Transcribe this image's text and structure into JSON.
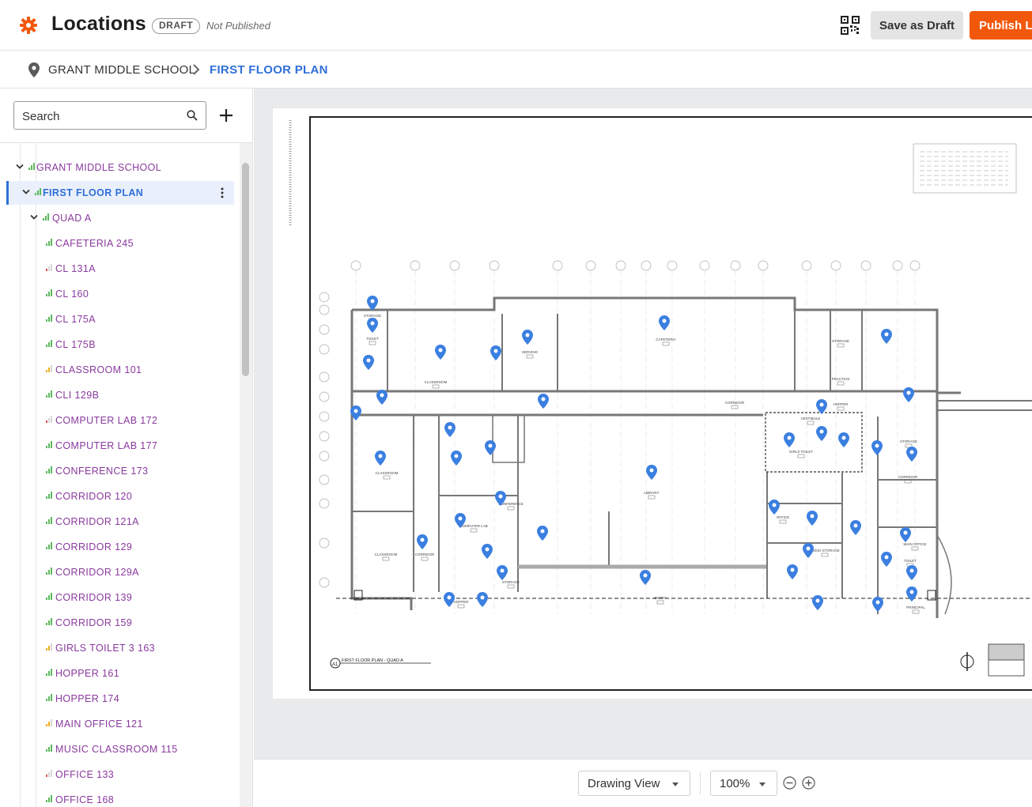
{
  "header": {
    "title": "Locations",
    "status_badge": "DRAFT",
    "publish_state": "Not Published",
    "save_draft_label": "Save as Draft",
    "publish_label": "Publish Lo",
    "logo_icon": "gear-logo-icon",
    "qr_icon": "qr-code-icon",
    "accent_color": "#f2580c"
  },
  "breadcrumb": {
    "items": [
      "GRANT MIDDLE SCHOOL",
      "FIRST FLOOR PLAN"
    ],
    "active_color": "#2f6fd8"
  },
  "sidebar": {
    "search_placeholder": "Search",
    "tree": [
      {
        "label": "GRANT MIDDLE SCHOOL",
        "level": 0,
        "expanded": true,
        "signal": "green"
      },
      {
        "label": "FIRST FLOOR PLAN",
        "level": 1,
        "expanded": true,
        "selected": true,
        "signal": "green"
      },
      {
        "label": "QUAD A",
        "level": 2,
        "expanded": true,
        "signal": "green"
      },
      {
        "label": "CAFETERIA 245",
        "level": 3,
        "signal": "green"
      },
      {
        "label": "CL 131A",
        "level": 3,
        "signal": "red"
      },
      {
        "label": "CL 160",
        "level": 3,
        "signal": "green"
      },
      {
        "label": "CL 175A",
        "level": 3,
        "signal": "green"
      },
      {
        "label": "CL 175B",
        "level": 3,
        "signal": "green"
      },
      {
        "label": "CLASSROOM 101",
        "level": 3,
        "signal": "yellow"
      },
      {
        "label": "CLI 129B",
        "level": 3,
        "signal": "green"
      },
      {
        "label": "COMPUTER LAB 172",
        "level": 3,
        "signal": "red"
      },
      {
        "label": "COMPUTER LAB 177",
        "level": 3,
        "signal": "green"
      },
      {
        "label": "CONFERENCE 173",
        "level": 3,
        "signal": "green"
      },
      {
        "label": "CORRIDOR 120",
        "level": 3,
        "signal": "green"
      },
      {
        "label": "CORRIDOR 121A",
        "level": 3,
        "signal": "green"
      },
      {
        "label": "CORRIDOR 129",
        "level": 3,
        "signal": "green"
      },
      {
        "label": "CORRIDOR 129A",
        "level": 3,
        "signal": "green"
      },
      {
        "label": "CORRIDOR 139",
        "level": 3,
        "signal": "green"
      },
      {
        "label": "CORRIDOR 159",
        "level": 3,
        "signal": "green"
      },
      {
        "label": "GIRLS TOILET 3 163",
        "level": 3,
        "signal": "yellow"
      },
      {
        "label": "HOPPER 161",
        "level": 3,
        "signal": "green"
      },
      {
        "label": "HOPPER 174",
        "level": 3,
        "signal": "green"
      },
      {
        "label": "MAIN OFFICE 121",
        "level": 3,
        "signal": "yellow"
      },
      {
        "label": "MUSIC CLASSROOM 115",
        "level": 3,
        "signal": "green"
      },
      {
        "label": "OFFICE 133",
        "level": 3,
        "signal": "red"
      },
      {
        "label": "OFFICE 168",
        "level": 3,
        "signal": "green"
      }
    ],
    "label_color": "#8a3a9e",
    "signal_colors": {
      "green": "#5cb85c",
      "yellow": "#f0ad1e",
      "red": "#e05252"
    }
  },
  "drawing": {
    "sheet_label": "A1",
    "sheet_title": "FIRST FLOOR PLAN - QUAD A",
    "room_labels": [
      "STORAGE",
      "TOILET",
      "CAFETERIA",
      "SERVING",
      "CLASSROOM",
      "STORAGE",
      "PRACTICE",
      "CORRIDOR",
      "HOPPER",
      "VESTIBULE",
      "GIRLS TOILET",
      "STORAGE",
      "CORRIDOR",
      "LIBRARY",
      "OFFICE",
      "CLASSROOM",
      "CORRIDOR",
      "COMPUTER LAB",
      "CONFERENCE",
      "AUDIO STORAGE",
      "MAIN OFFICE",
      "TOILET",
      "PRINCIPAL",
      "HOPPER",
      "STORAGE",
      "CLASSROOM",
      "ENTRY"
    ],
    "pin_color": "#3b7fe0",
    "pin_icon": "location-pin-icon"
  },
  "footer": {
    "view_mode": "Drawing View",
    "zoom": "100%",
    "zoom_out_icon": "zoom-out-icon",
    "zoom_in_icon": "zoom-in-icon"
  }
}
